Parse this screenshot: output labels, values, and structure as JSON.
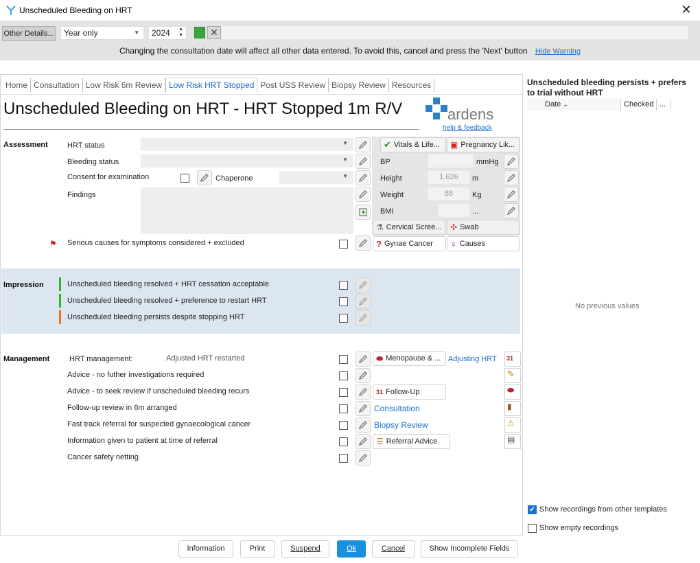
{
  "window": {
    "title": "Unscheduled Bleeding on HRT"
  },
  "toolbar": {
    "other_details": "Other Details...",
    "date_mode": "Year only",
    "year": "2024",
    "warning": "Changing the consultation date will affect all other data entered. To avoid this, cancel and press the 'Next' button",
    "hide_warning": "Hide Warning"
  },
  "tabs": [
    "Home",
    "Consultation",
    "Low Risk 6m Review",
    "Low Risk HRT Stopped",
    "Post USS Review",
    "Biopsy Review",
    "Resources"
  ],
  "active_tab": "Low Risk HRT Stopped",
  "page": {
    "title": "Unscheduled Bleeding on HRT - HRT Stopped 1m R/V",
    "logo": "ardens",
    "help_link": "help & feedback"
  },
  "assessment": {
    "label": "Assessment",
    "hrt_status": "HRT status",
    "bleeding_status": "Bleeding status",
    "consent": "Consent for examination",
    "chaperone": "Chaperone",
    "findings": "Findings",
    "serious_causes": "Serious causes for symptoms considered + excluded"
  },
  "vitals": {
    "vitals_btn": "Vitals & Life...",
    "pregnancy_btn": "Pregnancy Lik...",
    "bp_label": "BP",
    "bp_unit": "mmHg",
    "height_label": "Height",
    "height_value": "1.626",
    "height_unit": "m",
    "weight_label": "Weight",
    "weight_value": "88",
    "weight_unit": "Kg",
    "bmi_label": "BMI",
    "bmi_unit": "...",
    "cervical_btn": "Cervical Scree...",
    "swab_btn": "Swab",
    "gynae_btn": "Gynae Cancer",
    "causes_btn": "Causes"
  },
  "impression": {
    "label": "Impression",
    "items": [
      {
        "text": "Unscheduled bleeding resolved + HRT cessation acceptable",
        "color": "#2db52d"
      },
      {
        "text": "Unscheduled bleeding resolved + preference to restart HRT",
        "color": "#2db52d"
      },
      {
        "text": "Unscheduled bleeding persists despite stopping HRT",
        "color": "#f07020"
      }
    ]
  },
  "management": {
    "label": "Management",
    "hrt_mgmt": "HRT management:",
    "hrt_mgmt_value": "Adjusted HRT restarted",
    "items": [
      "Advice - no futher investigations required",
      "Advice - to seek review if unscheduled bleeding recurs",
      "Follow-up review in 6m arranged",
      "Fast track referral for suspected gynaecological cancer",
      "Information given to patient at time of referral",
      "Cancer safety netting"
    ],
    "menopause_btn": "Menopause & ...",
    "adjusting_link": "Adjusting HRT",
    "followup_btn": "Follow-Up",
    "consultation_link": "Consultation",
    "biopsy_link": "Biopsy Review",
    "referral_btn": "Referral Advice"
  },
  "right_panel": {
    "title": "Unscheduled bleeding persists + prefers to trial without HRT",
    "col_date": "Date",
    "col_checked": "Checked",
    "col_more": "...",
    "empty": "No previous values",
    "show_other": "Show recordings from other templates",
    "show_other_checked": true,
    "show_empty": "Show empty recordings",
    "show_empty_checked": false
  },
  "footer": {
    "information": "Information",
    "print": "Print",
    "suspend": "Suspend",
    "ok": "Ok",
    "cancel": "Cancel",
    "show_incomplete": "Show Incomplete Fields"
  },
  "colors": {
    "accent": "#1a6fc9",
    "ok_button": "#1a8fe0",
    "impression_bg": "#dce6f1"
  }
}
